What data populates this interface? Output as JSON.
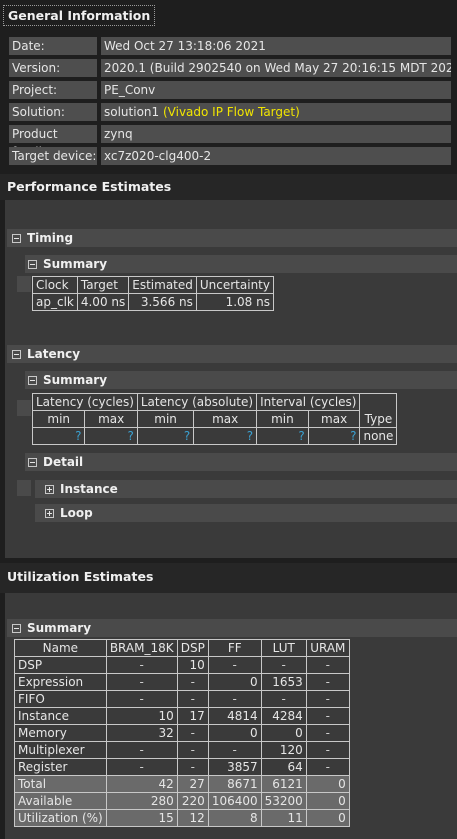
{
  "general": {
    "title": "General Information",
    "rows": [
      {
        "label": "Date:",
        "value": "Wed Oct 27 13:18:06 2021"
      },
      {
        "label": "Version:",
        "value": "2020.1 (Build 2902540 on Wed May 27 20:16:15 MDT 2020)"
      },
      {
        "label": "Project:",
        "value": "PE_Conv"
      },
      {
        "label": "Solution:",
        "value": "solution1",
        "extra": "(Vivado IP Flow Target)"
      },
      {
        "label": "Product family:",
        "value": "zynq"
      },
      {
        "label": "Target device:",
        "value": "xc7z020-clg400-2"
      }
    ]
  },
  "performance": {
    "title": "Performance Estimates",
    "timing": {
      "label": "Timing",
      "summary_label": "Summary",
      "headers": [
        "Clock",
        "Target",
        "Estimated",
        "Uncertainty"
      ],
      "row": [
        "ap_clk",
        "4.00 ns",
        "3.566 ns",
        "1.08 ns"
      ]
    },
    "latency": {
      "label": "Latency",
      "summary_label": "Summary",
      "groups": [
        "Latency (cycles)",
        "Latency (absolute)",
        "Interval (cycles)"
      ],
      "subheaders": [
        "min",
        "max",
        "min",
        "max",
        "min",
        "max",
        "Type"
      ],
      "values": [
        "?",
        "?",
        "?",
        "?",
        "?",
        "?",
        "none"
      ],
      "detail_label": "Detail",
      "instance_label": "Instance",
      "loop_label": "Loop"
    }
  },
  "utilization": {
    "title": "Utilization Estimates",
    "summary_label": "Summary",
    "headers": [
      "Name",
      "BRAM_18K",
      "DSP",
      "FF",
      "LUT",
      "URAM"
    ],
    "rows": [
      [
        "DSP",
        "-",
        "10",
        "-",
        "-",
        "-"
      ],
      [
        "Expression",
        "-",
        "-",
        "0",
        "1653",
        "-"
      ],
      [
        "FIFO",
        "-",
        "-",
        "-",
        "-",
        "-"
      ],
      [
        "Instance",
        "10",
        "17",
        "4814",
        "4284",
        "-"
      ],
      [
        "Memory",
        "32",
        "-",
        "0",
        "0",
        "-"
      ],
      [
        "Multiplexer",
        "-",
        "-",
        "-",
        "120",
        "-"
      ],
      [
        "Register",
        "-",
        "-",
        "3857",
        "64",
        "-"
      ]
    ],
    "totals": [
      [
        "Total",
        "42",
        "27",
        "8671",
        "6121",
        "0"
      ],
      [
        "Available",
        "280",
        "220",
        "106400",
        "53200",
        "0"
      ],
      [
        "Utilization (%)",
        "15",
        "12",
        "8",
        "11",
        "0"
      ]
    ]
  }
}
